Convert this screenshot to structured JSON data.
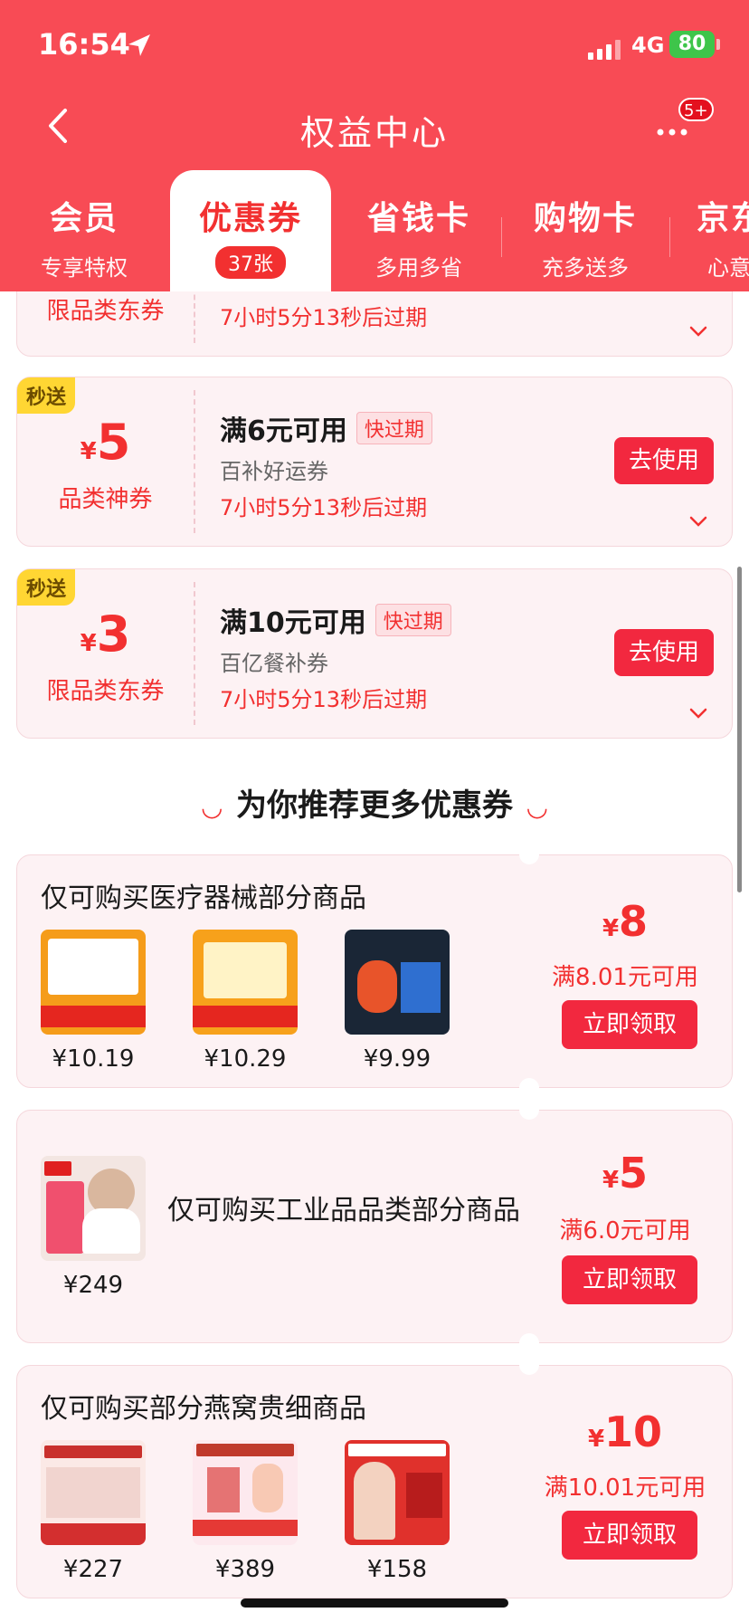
{
  "status": {
    "time": "16:54",
    "network": "4G",
    "battery": "80"
  },
  "nav": {
    "title": "权益中心",
    "badge": "5+"
  },
  "tabs": [
    {
      "title": "会员",
      "sub": "专享特权"
    },
    {
      "title": "优惠券",
      "sub": "37张"
    },
    {
      "title": "省钱卡",
      "sub": "多用多省"
    },
    {
      "title": "购物卡",
      "sub": "充多送多"
    },
    {
      "title": "京东",
      "sub": "心意"
    }
  ],
  "coupons": [
    {
      "name_label": "限品类东券",
      "expire": "7小时5分13秒后过期"
    },
    {
      "tag": "秒送",
      "yen": "¥",
      "amount": "5",
      "type": "品类神券",
      "condition": "满6元可用",
      "soon": "快过期",
      "name": "百补好运券",
      "expire": "7小时5分13秒后过期",
      "button": "去使用"
    },
    {
      "tag": "秒送",
      "yen": "¥",
      "amount": "3",
      "type": "限品类东券",
      "condition": "满10元可用",
      "soon": "快过期",
      "name": "百亿餐补券",
      "expire": "7小时5分13秒后过期",
      "button": "去使用"
    }
  ],
  "recommend": {
    "title": "为你推荐更多优惠券",
    "cards": [
      {
        "title": "仅可购买医疗器械部分商品",
        "yen": "¥",
        "amount": "8",
        "condition": "满8.01元可用",
        "button": "立即领取",
        "products": [
          {
            "price": "¥10.19"
          },
          {
            "price": "¥10.29"
          },
          {
            "price": "¥9.99"
          }
        ]
      },
      {
        "title": "仅可购买工业品品类部分商品",
        "yen": "¥",
        "amount": "5",
        "condition": "满6.0元可用",
        "button": "立即领取",
        "products": [
          {
            "price": "¥249"
          }
        ]
      },
      {
        "title": "仅可购买部分燕窝贵细商品",
        "yen": "¥",
        "amount": "10",
        "condition": "满10.01元可用",
        "button": "立即领取",
        "products": [
          {
            "price": "¥227"
          },
          {
            "price": "¥389"
          },
          {
            "price": "¥158"
          }
        ]
      }
    ]
  },
  "colors": {
    "brand": "#f84b55",
    "accent": "#f23030",
    "tag": "#ffd633"
  }
}
